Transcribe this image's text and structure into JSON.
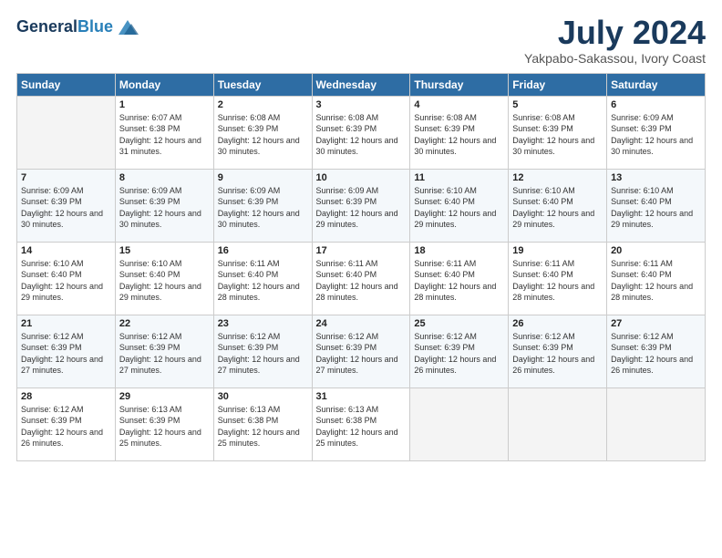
{
  "header": {
    "logo_line1": "General",
    "logo_line2": "Blue",
    "month_title": "July 2024",
    "location": "Yakpabo-Sakassou, Ivory Coast"
  },
  "weekdays": [
    "Sunday",
    "Monday",
    "Tuesday",
    "Wednesday",
    "Thursday",
    "Friday",
    "Saturday"
  ],
  "weeks": [
    [
      {
        "day": "",
        "sunrise": "",
        "sunset": "",
        "daylight": ""
      },
      {
        "day": "1",
        "sunrise": "Sunrise: 6:07 AM",
        "sunset": "Sunset: 6:38 PM",
        "daylight": "Daylight: 12 hours and 31 minutes."
      },
      {
        "day": "2",
        "sunrise": "Sunrise: 6:08 AM",
        "sunset": "Sunset: 6:39 PM",
        "daylight": "Daylight: 12 hours and 30 minutes."
      },
      {
        "day": "3",
        "sunrise": "Sunrise: 6:08 AM",
        "sunset": "Sunset: 6:39 PM",
        "daylight": "Daylight: 12 hours and 30 minutes."
      },
      {
        "day": "4",
        "sunrise": "Sunrise: 6:08 AM",
        "sunset": "Sunset: 6:39 PM",
        "daylight": "Daylight: 12 hours and 30 minutes."
      },
      {
        "day": "5",
        "sunrise": "Sunrise: 6:08 AM",
        "sunset": "Sunset: 6:39 PM",
        "daylight": "Daylight: 12 hours and 30 minutes."
      },
      {
        "day": "6",
        "sunrise": "Sunrise: 6:09 AM",
        "sunset": "Sunset: 6:39 PM",
        "daylight": "Daylight: 12 hours and 30 minutes."
      }
    ],
    [
      {
        "day": "7",
        "sunrise": "Sunrise: 6:09 AM",
        "sunset": "Sunset: 6:39 PM",
        "daylight": "Daylight: 12 hours and 30 minutes."
      },
      {
        "day": "8",
        "sunrise": "Sunrise: 6:09 AM",
        "sunset": "Sunset: 6:39 PM",
        "daylight": "Daylight: 12 hours and 30 minutes."
      },
      {
        "day": "9",
        "sunrise": "Sunrise: 6:09 AM",
        "sunset": "Sunset: 6:39 PM",
        "daylight": "Daylight: 12 hours and 30 minutes."
      },
      {
        "day": "10",
        "sunrise": "Sunrise: 6:09 AM",
        "sunset": "Sunset: 6:39 PM",
        "daylight": "Daylight: 12 hours and 29 minutes."
      },
      {
        "day": "11",
        "sunrise": "Sunrise: 6:10 AM",
        "sunset": "Sunset: 6:40 PM",
        "daylight": "Daylight: 12 hours and 29 minutes."
      },
      {
        "day": "12",
        "sunrise": "Sunrise: 6:10 AM",
        "sunset": "Sunset: 6:40 PM",
        "daylight": "Daylight: 12 hours and 29 minutes."
      },
      {
        "day": "13",
        "sunrise": "Sunrise: 6:10 AM",
        "sunset": "Sunset: 6:40 PM",
        "daylight": "Daylight: 12 hours and 29 minutes."
      }
    ],
    [
      {
        "day": "14",
        "sunrise": "Sunrise: 6:10 AM",
        "sunset": "Sunset: 6:40 PM",
        "daylight": "Daylight: 12 hours and 29 minutes."
      },
      {
        "day": "15",
        "sunrise": "Sunrise: 6:10 AM",
        "sunset": "Sunset: 6:40 PM",
        "daylight": "Daylight: 12 hours and 29 minutes."
      },
      {
        "day": "16",
        "sunrise": "Sunrise: 6:11 AM",
        "sunset": "Sunset: 6:40 PM",
        "daylight": "Daylight: 12 hours and 28 minutes."
      },
      {
        "day": "17",
        "sunrise": "Sunrise: 6:11 AM",
        "sunset": "Sunset: 6:40 PM",
        "daylight": "Daylight: 12 hours and 28 minutes."
      },
      {
        "day": "18",
        "sunrise": "Sunrise: 6:11 AM",
        "sunset": "Sunset: 6:40 PM",
        "daylight": "Daylight: 12 hours and 28 minutes."
      },
      {
        "day": "19",
        "sunrise": "Sunrise: 6:11 AM",
        "sunset": "Sunset: 6:40 PM",
        "daylight": "Daylight: 12 hours and 28 minutes."
      },
      {
        "day": "20",
        "sunrise": "Sunrise: 6:11 AM",
        "sunset": "Sunset: 6:40 PM",
        "daylight": "Daylight: 12 hours and 28 minutes."
      }
    ],
    [
      {
        "day": "21",
        "sunrise": "Sunrise: 6:12 AM",
        "sunset": "Sunset: 6:39 PM",
        "daylight": "Daylight: 12 hours and 27 minutes."
      },
      {
        "day": "22",
        "sunrise": "Sunrise: 6:12 AM",
        "sunset": "Sunset: 6:39 PM",
        "daylight": "Daylight: 12 hours and 27 minutes."
      },
      {
        "day": "23",
        "sunrise": "Sunrise: 6:12 AM",
        "sunset": "Sunset: 6:39 PM",
        "daylight": "Daylight: 12 hours and 27 minutes."
      },
      {
        "day": "24",
        "sunrise": "Sunrise: 6:12 AM",
        "sunset": "Sunset: 6:39 PM",
        "daylight": "Daylight: 12 hours and 27 minutes."
      },
      {
        "day": "25",
        "sunrise": "Sunrise: 6:12 AM",
        "sunset": "Sunset: 6:39 PM",
        "daylight": "Daylight: 12 hours and 26 minutes."
      },
      {
        "day": "26",
        "sunrise": "Sunrise: 6:12 AM",
        "sunset": "Sunset: 6:39 PM",
        "daylight": "Daylight: 12 hours and 26 minutes."
      },
      {
        "day": "27",
        "sunrise": "Sunrise: 6:12 AM",
        "sunset": "Sunset: 6:39 PM",
        "daylight": "Daylight: 12 hours and 26 minutes."
      }
    ],
    [
      {
        "day": "28",
        "sunrise": "Sunrise: 6:12 AM",
        "sunset": "Sunset: 6:39 PM",
        "daylight": "Daylight: 12 hours and 26 minutes."
      },
      {
        "day": "29",
        "sunrise": "Sunrise: 6:13 AM",
        "sunset": "Sunset: 6:39 PM",
        "daylight": "Daylight: 12 hours and 25 minutes."
      },
      {
        "day": "30",
        "sunrise": "Sunrise: 6:13 AM",
        "sunset": "Sunset: 6:38 PM",
        "daylight": "Daylight: 12 hours and 25 minutes."
      },
      {
        "day": "31",
        "sunrise": "Sunrise: 6:13 AM",
        "sunset": "Sunset: 6:38 PM",
        "daylight": "Daylight: 12 hours and 25 minutes."
      },
      {
        "day": "",
        "sunrise": "",
        "sunset": "",
        "daylight": ""
      },
      {
        "day": "",
        "sunrise": "",
        "sunset": "",
        "daylight": ""
      },
      {
        "day": "",
        "sunrise": "",
        "sunset": "",
        "daylight": ""
      }
    ]
  ]
}
